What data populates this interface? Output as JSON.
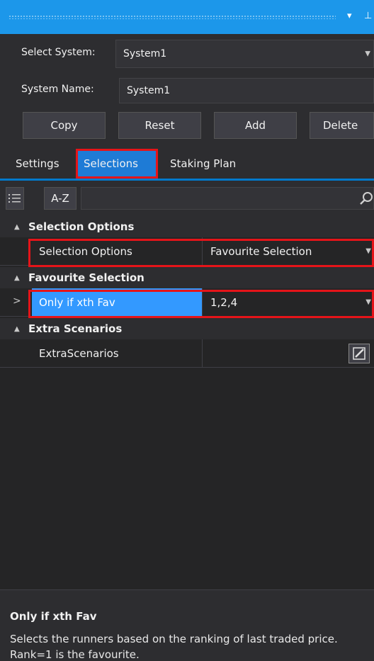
{
  "titlebar": {
    "menu_glyph": "▾",
    "pin_glyph": "⊥"
  },
  "system": {
    "select_label": "Select System:",
    "select_value": "System1",
    "name_label": "System Name:",
    "name_value": "System1"
  },
  "buttons": {
    "copy": "Copy",
    "reset": "Reset",
    "add": "Add",
    "delete": "Delete"
  },
  "tabs": [
    {
      "label": "Settings"
    },
    {
      "label": "Selections",
      "active": true
    },
    {
      "label": "Staking Plan"
    }
  ],
  "toolbar": {
    "az_label": "A-Z",
    "search_value": ""
  },
  "grid": {
    "cat1": "Selection Options",
    "prop1_name": "Selection Options",
    "prop1_value": "Favourite Selection",
    "cat2": "Favourite Selection",
    "prop2_name": "Only if xth Fav",
    "prop2_value": "1,2,4",
    "cat3": "Extra Scenarios",
    "prop3_name": "ExtraScenarios",
    "prop3_value": ""
  },
  "description": {
    "title": "Only if xth Fav",
    "text": "Selects the runners based on the ranking of last traded price. Rank=1 is the favourite."
  },
  "colors": {
    "accent": "#1c97ea",
    "highlight": "#e51419",
    "selected": "#3399ff"
  }
}
